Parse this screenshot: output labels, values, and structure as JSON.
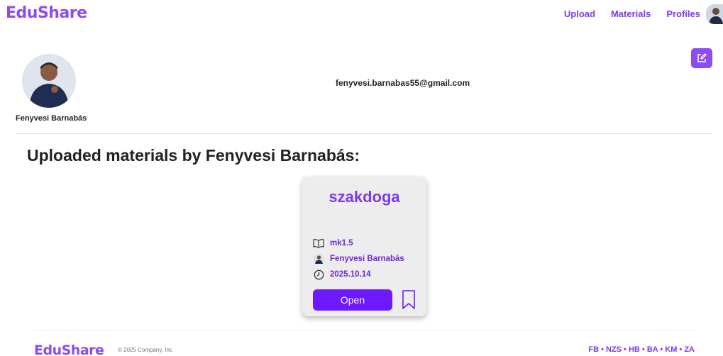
{
  "brand": {
    "name": "EduShare",
    "color": "#8b4cf0"
  },
  "nav": {
    "items": [
      "Upload",
      "Materials",
      "Profiles"
    ]
  },
  "profile": {
    "name": "Fenyvesi Barnabás",
    "email": "fenyvesi.barnabas55@gmail.com",
    "edit_icon": "edit-icon"
  },
  "section": {
    "title": "Uploaded materials by Fenyvesi Barnabás:"
  },
  "materials": [
    {
      "title": "szakdoga",
      "subject": "mk1.5",
      "author": "Fenyvesi Barnabás",
      "date": "2025.10.14",
      "open_label": "Open"
    }
  ],
  "footer": {
    "copyright": "© 2025 Company, Inc",
    "links": "FB • NZS • HB • BA • KM • ZA"
  },
  "colors": {
    "accent": "#7c3aed",
    "button": "#6d1aff"
  }
}
